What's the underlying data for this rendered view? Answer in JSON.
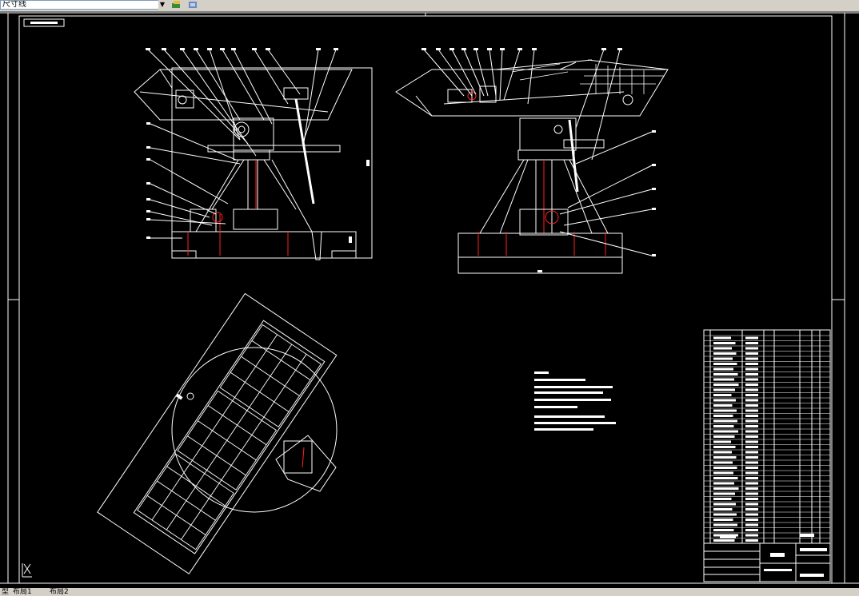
{
  "toolbar": {
    "layer_dropdown_value": "尺寸线",
    "layer_arrow": "▼"
  },
  "layout_tabs": {
    "model_fragment": "型",
    "tab1": "布局1",
    "tab2": "布局2"
  },
  "colors": {
    "background": "#000000",
    "line_white": "#ffffff",
    "line_red": "#ff2020",
    "toolbar_gray": "#d4d0c8"
  },
  "icons": [
    "layer-tools-icon",
    "layer-match-icon",
    "ucs-icon"
  ]
}
